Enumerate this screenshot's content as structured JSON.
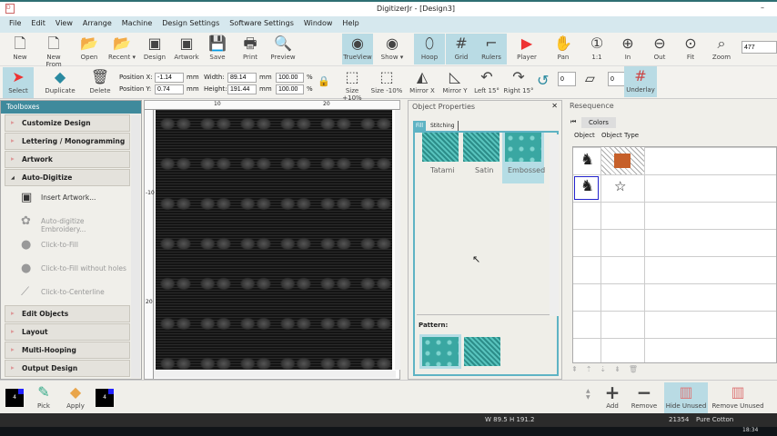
{
  "window": {
    "title": "DigitizerJr - [Design3]"
  },
  "menu": [
    "File",
    "Edit",
    "View",
    "Arrange",
    "Machine",
    "Design Settings",
    "Software Settings",
    "Window",
    "Help"
  ],
  "toolbar1": [
    {
      "label": "New",
      "icon": "new-file-icon"
    },
    {
      "label": "New From",
      "icon": "new-from-icon"
    },
    {
      "label": "Open",
      "icon": "folder-open-icon"
    },
    {
      "label": "Recent ▾",
      "icon": "recent-folder-icon"
    },
    {
      "label": "Design",
      "icon": "insert-design-icon"
    },
    {
      "label": "Artwork",
      "icon": "insert-artwork-icon"
    },
    {
      "label": "Save",
      "icon": "save-icon"
    },
    {
      "label": "Print",
      "icon": "print-icon"
    },
    {
      "label": "Preview",
      "icon": "preview-icon"
    },
    {
      "label": "TrueView",
      "icon": "trueview-icon",
      "active": true
    },
    {
      "label": "Show ▾",
      "icon": "show-icon"
    },
    {
      "label": "Hoop",
      "icon": "hoop-icon",
      "active": true
    },
    {
      "label": "Grid",
      "icon": "grid-icon",
      "active": true
    },
    {
      "label": "Rulers",
      "icon": "rulers-icon",
      "active": true
    },
    {
      "label": "Player",
      "icon": "player-icon"
    },
    {
      "label": "Pan",
      "icon": "pan-icon"
    },
    {
      "label": "1:1",
      "icon": "zoom-1to1-icon"
    },
    {
      "label": "In",
      "icon": "zoom-in-icon"
    },
    {
      "label": "Out",
      "icon": "zoom-out-icon"
    },
    {
      "label": "Fit",
      "icon": "zoom-fit-icon"
    },
    {
      "label": "Zoom",
      "icon": "zoom-icon"
    }
  ],
  "zoom_value": "477",
  "toolbar2": {
    "select": "Select",
    "duplicate": "Duplicate",
    "delete": "Delete",
    "pos_x_label": "Position X:",
    "pos_x": "-1.14",
    "pos_y_label": "Position Y:",
    "pos_y": "0.74",
    "width_label": "Width:",
    "width": "89.14",
    "height_label": "Height:",
    "height": "191.44",
    "unit": "mm",
    "pct_w": "100.00",
    "pct_h": "100.00",
    "pct": "%",
    "buttons": [
      "Size +10%",
      "Size -10%",
      "Mirror X",
      "Mirror Y",
      "Left 15°",
      "Right 15°"
    ],
    "rotate_value": "0",
    "skew_value": "0",
    "underlay": "Underlay"
  },
  "toolboxes": {
    "title": "Toolboxes",
    "sections_top": [
      "Customize Design",
      "Lettering / Monogramming",
      "Artwork"
    ],
    "open_section": "Auto-Digitize",
    "items": [
      {
        "label": "Insert Artwork...",
        "enabled": true,
        "icon": "insert-artwork-icon"
      },
      {
        "label": "Auto-digitize Embroidery...",
        "enabled": false,
        "icon": "auto-digitize-icon"
      },
      {
        "label": "Click-to-Fill",
        "enabled": false,
        "icon": "click-fill-icon"
      },
      {
        "label": "Click-to-Fill without holes",
        "enabled": false,
        "icon": "click-fill-no-holes-icon"
      },
      {
        "label": "Click-to-Centerline",
        "enabled": false,
        "icon": "click-centerline-icon"
      }
    ],
    "sections_bottom": [
      "Edit Objects",
      "Layout",
      "Multi-Hooping",
      "Output Design"
    ]
  },
  "ruler": {
    "marks": [
      "10",
      "20",
      "-10",
      "20"
    ]
  },
  "object_properties": {
    "title": "Object Properties",
    "tabs": [
      "Fill",
      "Stitching"
    ],
    "fill_types": [
      "Tatami",
      "Satin",
      "Embossed"
    ],
    "selected_fill": "Embossed",
    "pattern_label": "Pattern:"
  },
  "resequence": {
    "title": "Resequence",
    "colors_btn": "Colors",
    "columns": [
      "Object",
      "Object Type"
    ]
  },
  "bottom": {
    "pick": "Pick",
    "apply": "Apply",
    "swatch_num": "4",
    "add": "Add",
    "remove": "Remove",
    "hide_unused": "Hide Unused",
    "remove_unused": "Remove Unused"
  },
  "status": {
    "dims": "W 89.5 H 191.2",
    "stitches": "21354",
    "thread": "Pure Cotton",
    "time": "18:34"
  }
}
